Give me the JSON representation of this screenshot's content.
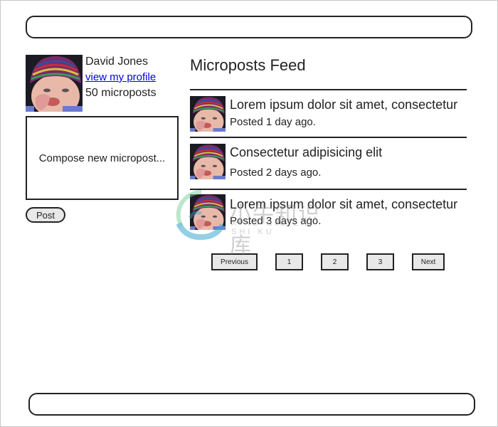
{
  "user": {
    "name": "David Jones",
    "profile_link": "view my profile",
    "post_count": "50 microposts",
    "avatar_icon": "user-photo"
  },
  "compose": {
    "placeholder": "Compose new micropost...",
    "post_label": "Post"
  },
  "feed": {
    "title": "Microposts Feed",
    "items": [
      {
        "text": "Lorem ipsum dolor sit amet, consectetur",
        "time": "Posted 1 day ago."
      },
      {
        "text": "Consectetur adipisicing elit",
        "time": "Posted 2 days ago."
      },
      {
        "text": "Lorem ipsum dolor sit amet, consectetur",
        "time": "Posted 3 days ago."
      }
    ]
  },
  "pagination": {
    "previous": "Previous",
    "pages": [
      "1",
      "2",
      "3"
    ],
    "next": "Next"
  },
  "watermark": {
    "text": "小牛知识库",
    "subtext": "XIAO NIU ZHI SHI KU"
  }
}
